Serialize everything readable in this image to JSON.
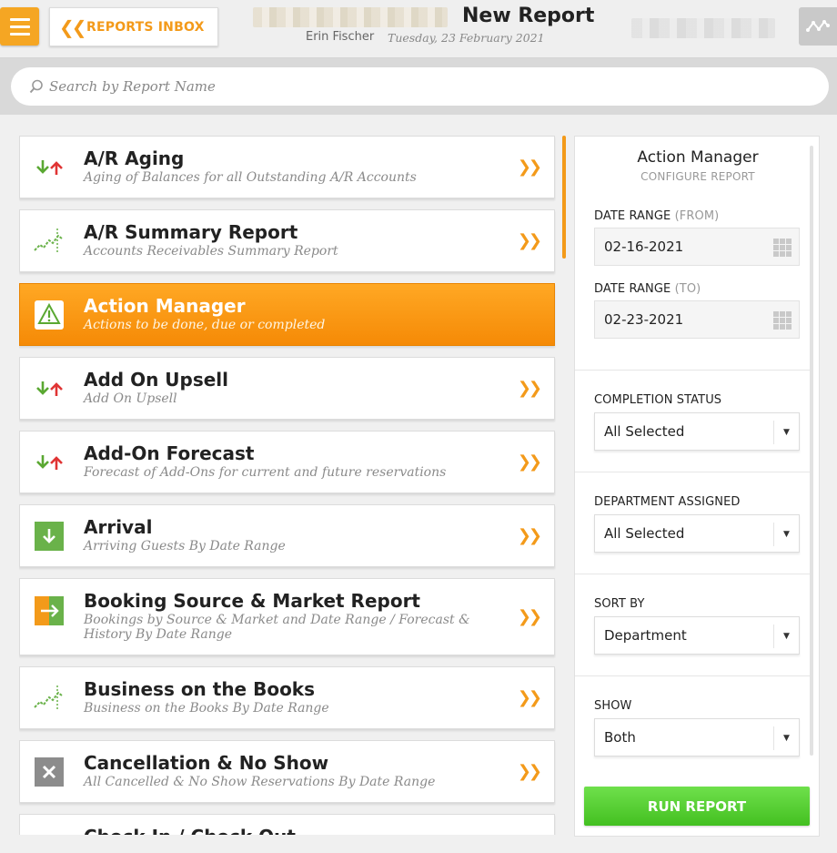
{
  "header": {
    "inbox_label": "REPORTS INBOX",
    "title": "New Report",
    "user": "Erin Fischer",
    "date": "Tuesday, 23 February 2021"
  },
  "search": {
    "placeholder": "Search by Report Name",
    "value": ""
  },
  "reports": [
    {
      "title": "A/R Aging",
      "subtitle": "Aging of Balances for all Outstanding A/R Accounts",
      "icon": "up-down-arrows-icon"
    },
    {
      "title": "A/R Summary Report",
      "subtitle": "Accounts Receivables Summary Report",
      "icon": "trend-chart-icon"
    },
    {
      "title": "Action Manager",
      "subtitle": "Actions to be done, due or completed",
      "icon": "alert-bubble-icon",
      "active": true
    },
    {
      "title": "Add On Upsell",
      "subtitle": "Add On Upsell",
      "icon": "up-down-arrows-icon"
    },
    {
      "title": "Add-On Forecast",
      "subtitle": "Forecast of Add-Ons for current and future reservations",
      "icon": "up-down-arrows-icon"
    },
    {
      "title": "Arrival",
      "subtitle": "Arriving Guests By Date Range",
      "icon": "arrival-arrow-icon"
    },
    {
      "title": "Booking Source & Market Report",
      "subtitle": "Bookings by Source & Market and Date Range / Forecast & History By Date Range",
      "icon": "booking-source-icon"
    },
    {
      "title": "Business on the Books",
      "subtitle": "Business on the Books By Date Range",
      "icon": "trend-chart-icon"
    },
    {
      "title": "Cancellation & No Show",
      "subtitle": "All Cancelled & No Show Reservations By Date Range",
      "icon": "cancel-x-icon"
    },
    {
      "title": "Check In / Check Out",
      "subtitle": "",
      "icon": "up-down-arrows-icon"
    }
  ],
  "panel": {
    "title": "Action Manager",
    "subtitle": "CONFIGURE REPORT",
    "date_from_label": "DATE RANGE",
    "date_from_suffix": "(FROM)",
    "date_from_value": "02-16-2021",
    "date_to_label": "DATE RANGE",
    "date_to_suffix": "(TO)",
    "date_to_value": "02-23-2021",
    "completion_label": "COMPLETION STATUS",
    "completion_value": "All Selected",
    "department_label": "DEPARTMENT ASSIGNED",
    "department_value": "All Selected",
    "sort_label": "SORT BY",
    "sort_value": "Department",
    "show_label": "SHOW",
    "show_value": "Both",
    "run_label": "RUN REPORT"
  },
  "colors": {
    "accent": "#f39a1a",
    "active_item": "#f58a06",
    "run_button": "#4fc82a",
    "arrow_down": "#5aa832",
    "arrow_up": "#e03434"
  }
}
